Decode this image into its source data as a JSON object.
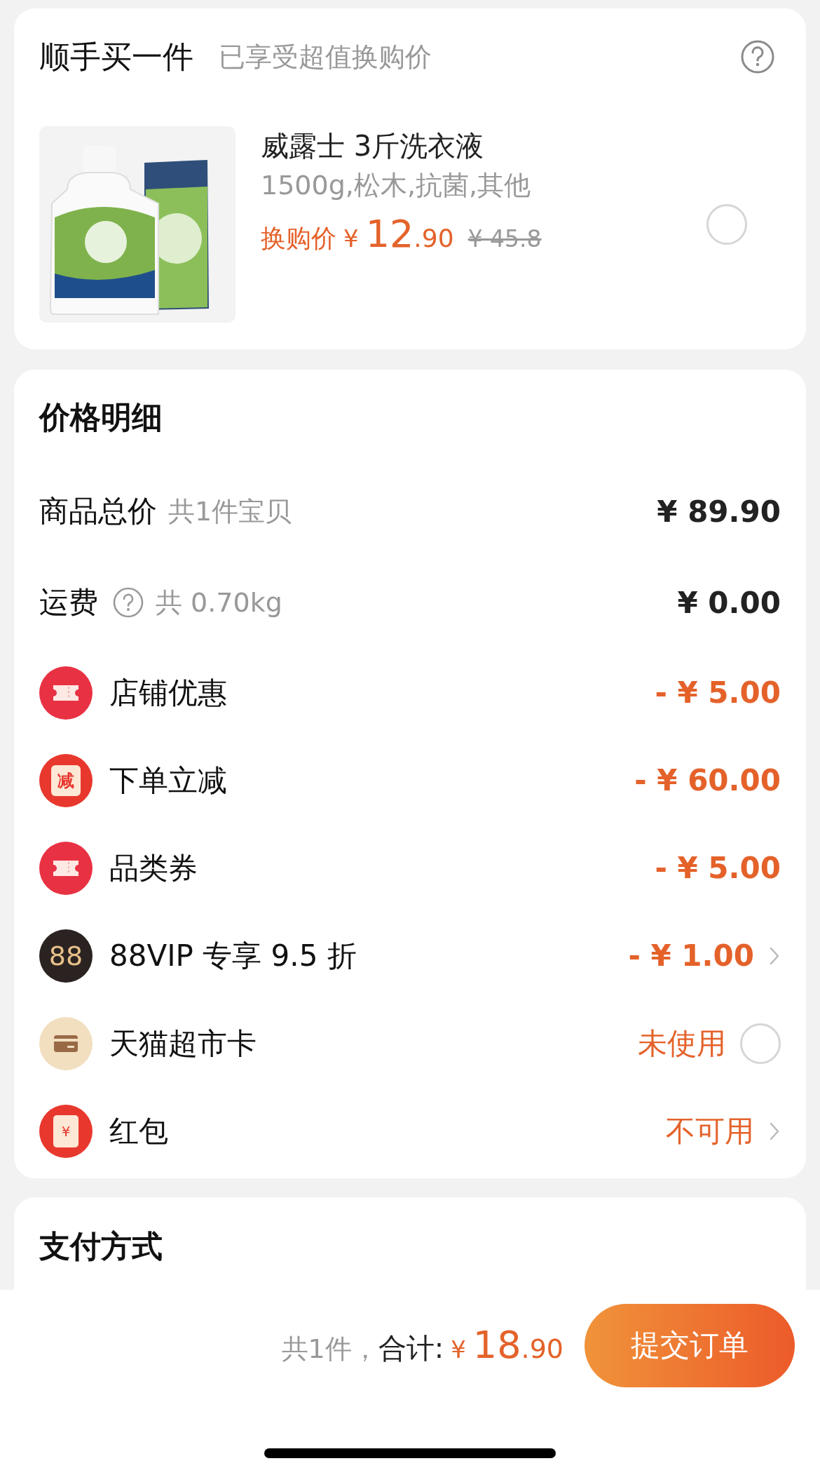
{
  "addon": {
    "title": "顺手买一件",
    "subtitle": "已享受超值换购价",
    "product": {
      "kind": "picture",
      "name": "威露士 3斤洗衣液",
      "spec": "1500g,松木,抗菌,其他",
      "price_label": "换购价",
      "currency": "¥",
      "price_int": "12",
      "price_dec": ".90",
      "original_price": "¥ 45.8",
      "checked": false
    }
  },
  "price_detail": {
    "title": "价格明细",
    "rows": [
      {
        "kind": "sum",
        "label": "商品总价",
        "note": "共1件宝贝",
        "value": "¥ 89.90"
      },
      {
        "kind": "shipping",
        "label": "运费",
        "note": "共 0.70kg",
        "value": "¥ 0.00"
      },
      {
        "kind": "ticket",
        "label": "店铺优惠",
        "value": "- ¥ 5.00"
      },
      {
        "kind": "reduce",
        "icon_text": "减",
        "label": "下单立减",
        "value": "- ¥ 60.00"
      },
      {
        "kind": "ticket",
        "label": "品类券",
        "value": "- ¥ 5.00"
      },
      {
        "kind": "vip",
        "icon_text": "88",
        "label": "88VIP 专享 9.5 折",
        "value": "- ¥ 1.00",
        "chevron": true
      },
      {
        "kind": "card",
        "label": "天猫超市卡",
        "value": "未使用",
        "checked": false
      },
      {
        "kind": "redpacket",
        "icon_text": "¥",
        "label": "红包",
        "value": "不可用",
        "chevron": true
      }
    ]
  },
  "payment": {
    "title": "支付方式"
  },
  "footer": {
    "count": "共1件，",
    "total_label": "合计:",
    "currency": "¥",
    "total_int": "18",
    "total_dec": ".90",
    "submit": "提交订单"
  }
}
